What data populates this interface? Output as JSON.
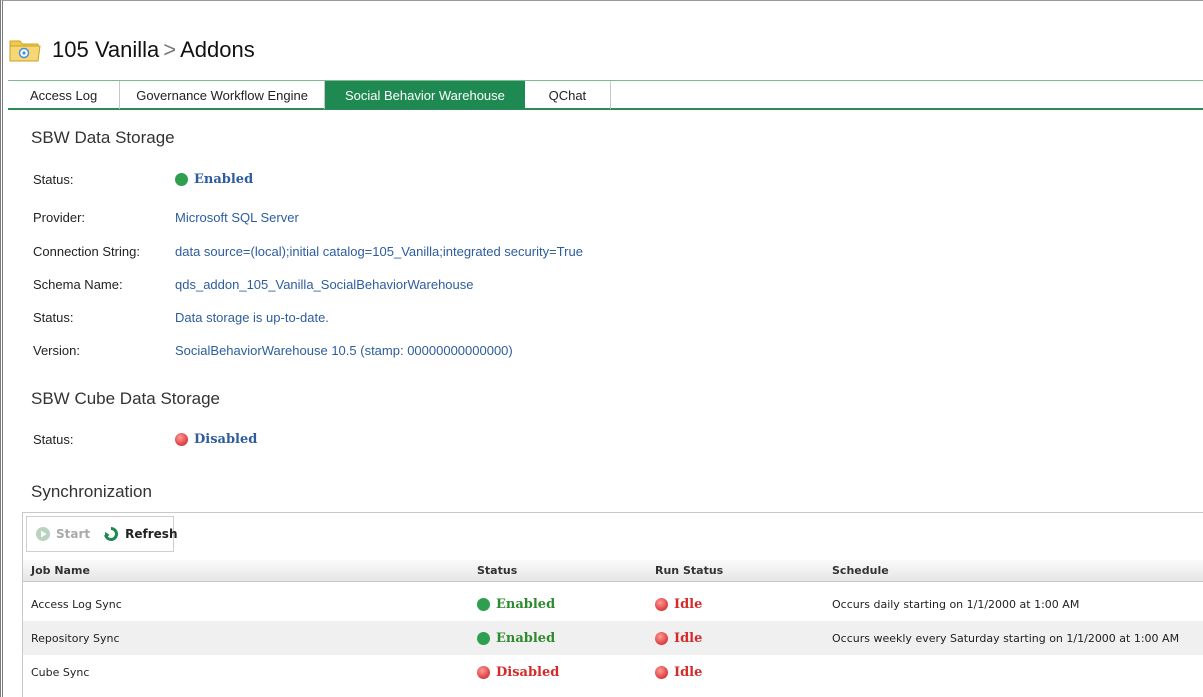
{
  "header": {
    "breadcrumb_root": "105 Vanilla",
    "breadcrumb_sep": ">",
    "breadcrumb_page": "Addons"
  },
  "tabs": [
    {
      "label": "Access Log",
      "active": false
    },
    {
      "label": "Governance Workflow Engine",
      "active": false
    },
    {
      "label": "Social Behavior Warehouse",
      "active": true
    },
    {
      "label": "QChat",
      "active": false
    }
  ],
  "data_storage": {
    "title": "SBW Data Storage",
    "status_label": "Status:",
    "status_value": "Enabled",
    "provider_label": "Provider:",
    "provider_value": "Microsoft SQL Server",
    "connection_label": "Connection String:",
    "connection_value": "data source=(local);initial catalog=105_Vanilla;integrated security=True",
    "schema_label": "Schema Name:",
    "schema_value": "qds_addon_105_Vanilla_SocialBehaviorWarehouse",
    "status2_label": "Status:",
    "status2_value": "Data storage is up-to-date.",
    "version_label": "Version:",
    "version_value": "SocialBehaviorWarehouse 10.5 (stamp: 00000000000000)"
  },
  "cube_storage": {
    "title": "SBW Cube Data Storage",
    "status_label": "Status:",
    "status_value": "Disabled"
  },
  "sync": {
    "title": "Synchronization",
    "start_label": "Start",
    "refresh_label": "Refresh",
    "columns": {
      "name": "Job Name",
      "status": "Status",
      "run_status": "Run Status",
      "schedule": "Schedule"
    },
    "rows": [
      {
        "name": "Access Log Sync",
        "status": "Enabled",
        "run_status": "Idle",
        "schedule": "Occurs daily starting on 1/1/2000 at 1:00 AM"
      },
      {
        "name": "Repository Sync",
        "status": "Enabled",
        "run_status": "Idle",
        "schedule": "Occurs weekly every Saturday starting on 1/1/2000 at 1:00 AM"
      },
      {
        "name": "Cube Sync",
        "status": "Disabled",
        "run_status": "Idle",
        "schedule": ""
      }
    ]
  },
  "colors": {
    "accent": "#1e8a52",
    "link": "#2d5d9e",
    "enabled": "#2e9e4f",
    "disabled": "#d42a2a"
  }
}
